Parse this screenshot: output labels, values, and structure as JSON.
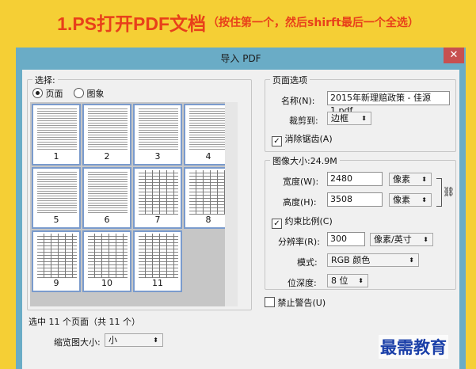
{
  "banner": {
    "main": "1.PS打开PDF文档",
    "sub": "（按住第一个，然后shirft最后一个全选）"
  },
  "dialog": {
    "title": "导入 PDF",
    "close_icon": "close-icon",
    "select": {
      "label": "选择:",
      "page_option": "页面",
      "image_option": "图象",
      "selected": "页面",
      "thumbnails": [
        {
          "num": "1",
          "kind": "text"
        },
        {
          "num": "2",
          "kind": "text"
        },
        {
          "num": "3",
          "kind": "text"
        },
        {
          "num": "4",
          "kind": "text"
        },
        {
          "num": "5",
          "kind": "text"
        },
        {
          "num": "6",
          "kind": "text"
        },
        {
          "num": "7",
          "kind": "table"
        },
        {
          "num": "8",
          "kind": "table"
        },
        {
          "num": "9",
          "kind": "table"
        },
        {
          "num": "10",
          "kind": "table"
        },
        {
          "num": "11",
          "kind": "table"
        }
      ],
      "status": "选中 11 个页面（共 11 个）",
      "thumb_size_label": "缩览图大小:",
      "thumb_size_value": "小"
    },
    "page_options": {
      "label": "页面选项",
      "name_label": "名称(N):",
      "name_value": "2015年新理赔政策 - 佳源1.pdf",
      "crop_label": "裁剪到:",
      "crop_value": "边框",
      "antialias_label": "消除锯齿(A)",
      "antialias_checked": true
    },
    "image_size": {
      "label": "图像大小:24.9M",
      "width_label": "宽度(W):",
      "width_value": "2480",
      "width_unit": "像素",
      "height_label": "高度(H):",
      "height_value": "3508",
      "height_unit": "像素",
      "constrain_label": "约束比例(C)",
      "constrain_checked": true,
      "res_label": "分辨率(R):",
      "res_value": "300",
      "res_unit": "像素/英寸",
      "mode_label": "模式:",
      "mode_value": "RGB 颜色",
      "depth_label": "位深度:",
      "depth_value": "8 位"
    },
    "suppress_warnings_label": "禁止警告(U)",
    "suppress_warnings_checked": false,
    "check_mark": "✓"
  },
  "watermark": "最需教育"
}
